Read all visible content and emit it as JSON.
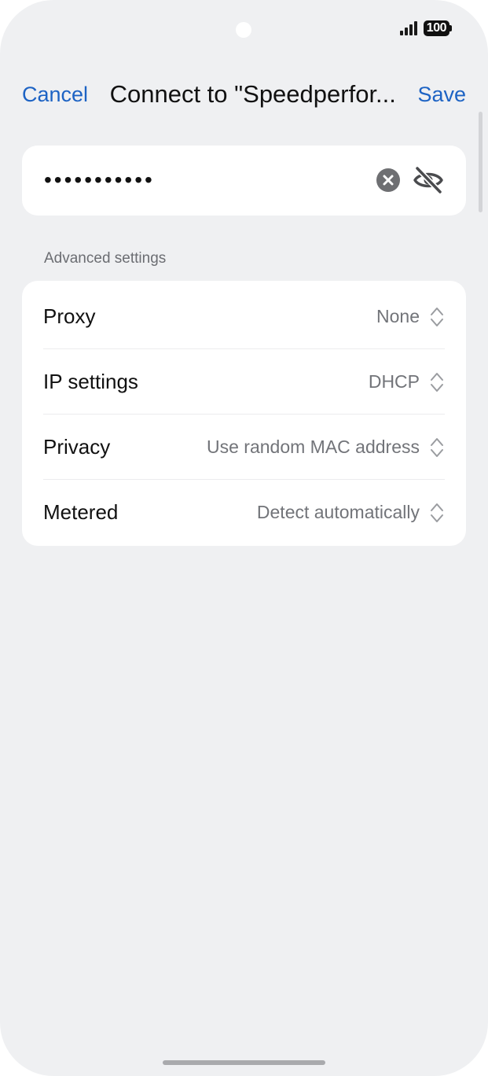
{
  "status_bar": {
    "battery_level": "100",
    "signal_icon": "signal-bars-icon"
  },
  "header": {
    "cancel_label": "Cancel",
    "title": "Connect to \"Speedperfor...",
    "save_label": "Save"
  },
  "password": {
    "masked_value": "•••••••••••",
    "clear_icon": "clear-icon",
    "visibility_icon": "eye-off-icon"
  },
  "advanced": {
    "section_label": "Advanced settings",
    "rows": [
      {
        "label": "Proxy",
        "value": "None"
      },
      {
        "label": "IP settings",
        "value": "DHCP"
      },
      {
        "label": "Privacy",
        "value": "Use random MAC address"
      },
      {
        "label": "Metered",
        "value": "Detect automatically"
      }
    ]
  },
  "colors": {
    "accent": "#1d63c4",
    "background": "#eff0f2",
    "card": "#ffffff"
  }
}
